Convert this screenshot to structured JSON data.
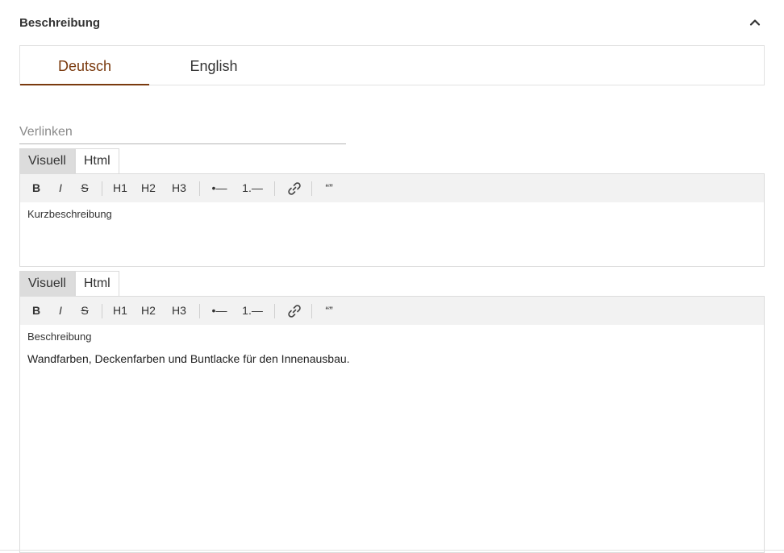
{
  "section": {
    "title": "Beschreibung",
    "collapse_icon": "chevron-up-icon"
  },
  "language_tabs": [
    {
      "label": "Deutsch",
      "active": true
    },
    {
      "label": "English",
      "active": false
    }
  ],
  "link_field": {
    "placeholder": "Verlinken",
    "value": ""
  },
  "editors": [
    {
      "mode_tabs": [
        {
          "label": "Visuell",
          "active": true
        },
        {
          "label": "Html",
          "active": false
        }
      ],
      "toolbar": {
        "bold": "B",
        "italic": "I",
        "strike": "S",
        "h1": "H1",
        "h2": "H2",
        "h3": "H3",
        "bullet_list": "•—",
        "ordered_list": "1.—",
        "link_icon": "link-icon",
        "quote": "“”"
      },
      "label": "Kurzbeschreibung",
      "content": ""
    },
    {
      "mode_tabs": [
        {
          "label": "Visuell",
          "active": true
        },
        {
          "label": "Html",
          "active": false
        }
      ],
      "toolbar": {
        "bold": "B",
        "italic": "I",
        "strike": "S",
        "h1": "H1",
        "h2": "H2",
        "h3": "H3",
        "bullet_list": "•—",
        "ordered_list": "1.—",
        "link_icon": "link-icon",
        "quote": "“”"
      },
      "label": "Beschreibung",
      "content": "Wandfarben, Deckenfarben und Buntlacke für den Innenausbau."
    }
  ],
  "colors": {
    "accent": "#7a3a0e",
    "toolbar_bg": "#f2f2f2",
    "active_mode_bg": "#dcdcdc",
    "border": "#dcdcdc"
  }
}
